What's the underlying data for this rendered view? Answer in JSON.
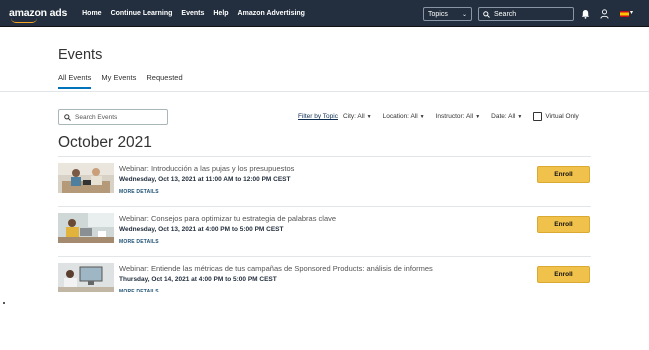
{
  "header": {
    "brand": "amazon ads",
    "nav": [
      "Home",
      "Continue Learning",
      "Events",
      "Help",
      "Amazon Advertising"
    ],
    "topics_label": "Topics",
    "search_placeholder": "Search"
  },
  "page": {
    "title": "Events",
    "tabs": [
      {
        "label": "All Events",
        "active": true
      },
      {
        "label": "My Events",
        "active": false
      },
      {
        "label": "Requested",
        "active": false
      }
    ]
  },
  "filters": {
    "search_placeholder": "Search Events",
    "filter_by": "Filter by Topic",
    "city": "City: All",
    "location": "Location: All",
    "instructor": "Instructor: All",
    "date": "Date: All",
    "virtual_only": "Virtual Only"
  },
  "month": "October 2021",
  "events": [
    {
      "title": "Webinar: Introducción a las pujas y los presupuestos",
      "date": "Wednesday, Oct 13, 2021 at 11:00 AM to 12:00 PM CEST",
      "more": "MORE DETAILS",
      "enroll": "Enroll"
    },
    {
      "title": "Webinar: Consejos para optimizar tu estrategia de palabras clave",
      "date": "Wednesday, Oct 13, 2021 at 4:00 PM to 5:00 PM CEST",
      "more": "MORE DETAILS",
      "enroll": "Enroll"
    },
    {
      "title": "Webinar: Entiende las métricas de tus campañas de Sponsored Products: análisis de informes",
      "date": "Thursday, Oct 14, 2021 at 4:00 PM to 5:00 PM CEST",
      "more": "MORE DETAILS",
      "enroll": "Enroll"
    }
  ],
  "colors": {
    "header_bg": "#232f3e",
    "accent_orange": "#f5a623",
    "enroll_bg": "#f0c14b",
    "tab_underline": "#0073bb"
  }
}
